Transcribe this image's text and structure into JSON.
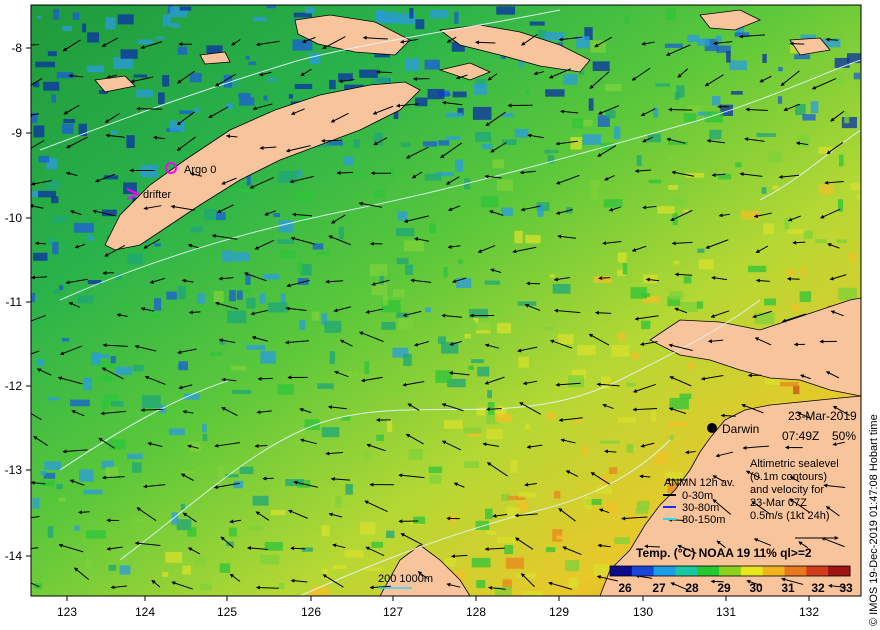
{
  "map": {
    "x_ticks": [
      "123",
      "124",
      "125",
      "126",
      "127",
      "128",
      "129",
      "130",
      "131",
      "132"
    ],
    "y_ticks": [
      "-8",
      "-9",
      "-10",
      "-11",
      "-12",
      "-13",
      "-14"
    ]
  },
  "markers": {
    "argo_label": "Argo 0",
    "drifter_label": "drifter"
  },
  "station": {
    "name": "Darwin",
    "date": "23-Mar-2019",
    "time": "07:49Z",
    "percent": "50%"
  },
  "sealevel_note": {
    "line1": "Altimetric sealevel",
    "line2": "(0.1m contours)",
    "line3": "and velocity for",
    "line4": "23-Mar 07Z",
    "line5": "0.5m/s (1kt 24h)"
  },
  "anmn_legend": {
    "title": "ANMN 12h av.",
    "items": [
      {
        "label": "0-30m",
        "color": "#000000"
      },
      {
        "label": "30-80m",
        "color": "#1030ff"
      },
      {
        "label": "80-150m",
        "color": "#20e0ff"
      }
    ]
  },
  "scale": {
    "label": "200  1000m"
  },
  "colorbar": {
    "title": "Temp. (°C) NOAA 19 11% ql>=2",
    "ticks": [
      "26",
      "27",
      "28",
      "29",
      "30",
      "31",
      "32",
      "33"
    ],
    "colors": [
      "#0a0a8c",
      "#1a46d8",
      "#1e9ce8",
      "#18c8a0",
      "#24c832",
      "#8ad21e",
      "#e6e61e",
      "#f0b41e",
      "#e8781e",
      "#d03c1e",
      "#a01414"
    ]
  },
  "credit": "© IMOS 19-Dec-2019 01:47:08 Hobart time"
}
